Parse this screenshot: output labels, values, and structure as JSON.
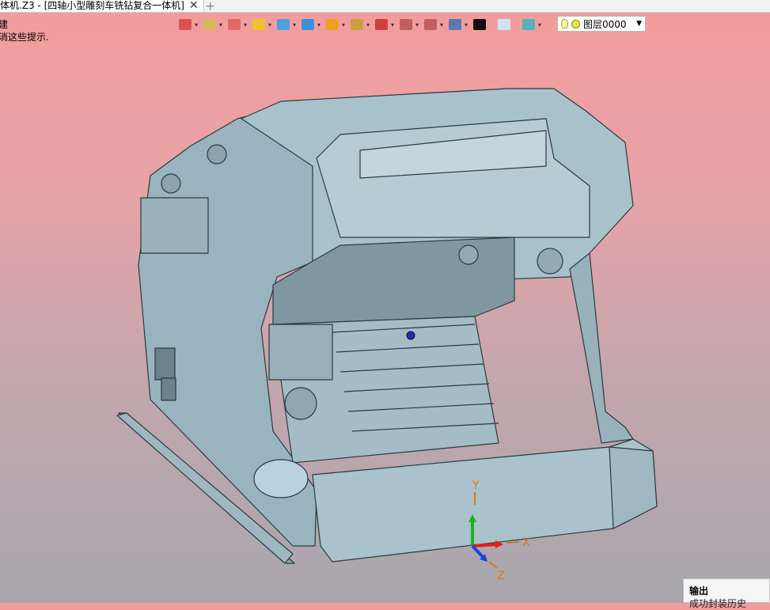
{
  "window": {
    "tab_title": "体机.Z3 - [四轴小型雕刻车铣钻复合一体机]",
    "add_tab": "+",
    "close_glyph": "✕"
  },
  "hints": {
    "line1": "建",
    "line2": "消这些提示."
  },
  "toolbar": {
    "items": [
      {
        "name": "exit-icon",
        "color": "#e05050"
      },
      {
        "name": "layers-icon",
        "color": "#d7b95a"
      },
      {
        "name": "pencil-icon",
        "color": "#e06a6a"
      },
      {
        "name": "box-icon",
        "color": "#f0c030"
      },
      {
        "name": "cube-icon",
        "color": "#4aa0e0"
      },
      {
        "name": "solid-icon",
        "color": "#3d8fd6"
      },
      {
        "name": "sphere-icon",
        "color": "#f0a020"
      },
      {
        "name": "view-icon",
        "color": "#c8a040"
      },
      {
        "name": "target-icon",
        "color": "#d04040"
      },
      {
        "name": "frame-icon",
        "color": "#c06060"
      },
      {
        "name": "measure-icon",
        "color": "#c06060"
      },
      {
        "name": "display-icon",
        "color": "#5a7ab0"
      },
      {
        "name": "color-black-icon",
        "color": "#111111"
      },
      {
        "name": "color-fill-icon",
        "color": "#cfe3f5"
      },
      {
        "name": "texture-icon",
        "color": "#56b0c0"
      }
    ],
    "layer": {
      "label": "图层0000",
      "bulb": "light-bulb-icon",
      "dot": "layer-color-dot-icon"
    }
  },
  "axes": {
    "x": "X",
    "y": "Y",
    "z": "Z"
  },
  "output_panel": {
    "title": "输出",
    "status": "成功封装历史"
  },
  "colors": {
    "model": "#9ab4bf",
    "model_edge": "#2a3a40",
    "bg_top": "#f39c9c",
    "bg_bottom": "#a7a7ad"
  }
}
